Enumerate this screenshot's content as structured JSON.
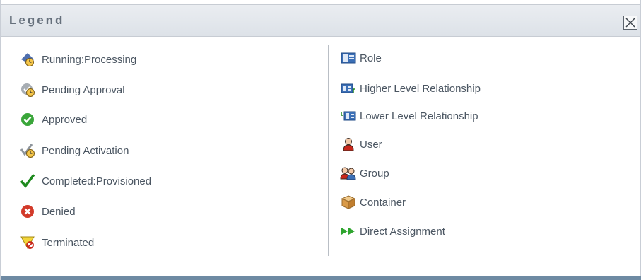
{
  "dialog": {
    "title": "Legend",
    "close_symbol": "X"
  },
  "left_items": [
    {
      "label": "Running:Processing",
      "icon": "running-processing-icon"
    },
    {
      "label": "Pending Approval",
      "icon": "pending-approval-icon"
    },
    {
      "label": "Approved",
      "icon": "approved-icon"
    },
    {
      "label": "Pending Activation",
      "icon": "pending-activation-icon"
    },
    {
      "label": "Completed:Provisioned",
      "icon": "completed-provisioned-icon"
    },
    {
      "label": "Denied",
      "icon": "denied-icon"
    },
    {
      "label": "Terminated",
      "icon": "terminated-icon"
    }
  ],
  "right_items": [
    {
      "label": "Role",
      "icon": "role-icon"
    },
    {
      "label": "Higher Level Relationship",
      "icon": "higher-level-relationship-icon"
    },
    {
      "label": "Lower Level Relationship",
      "icon": "lower-level-relationship-icon"
    },
    {
      "label": "User",
      "icon": "user-icon"
    },
    {
      "label": "Group",
      "icon": "group-icon"
    },
    {
      "label": "Container",
      "icon": "container-icon"
    },
    {
      "label": "Direct Assignment",
      "icon": "direct-assignment-icon"
    }
  ],
  "colors": {
    "header_text": "#66707c",
    "label_text": "#4b5662",
    "approved_green": "#3aa63a",
    "denied_red": "#d23a2a",
    "role_blue": "#3b6fb6",
    "footer_bar": "#6e8aa3"
  }
}
